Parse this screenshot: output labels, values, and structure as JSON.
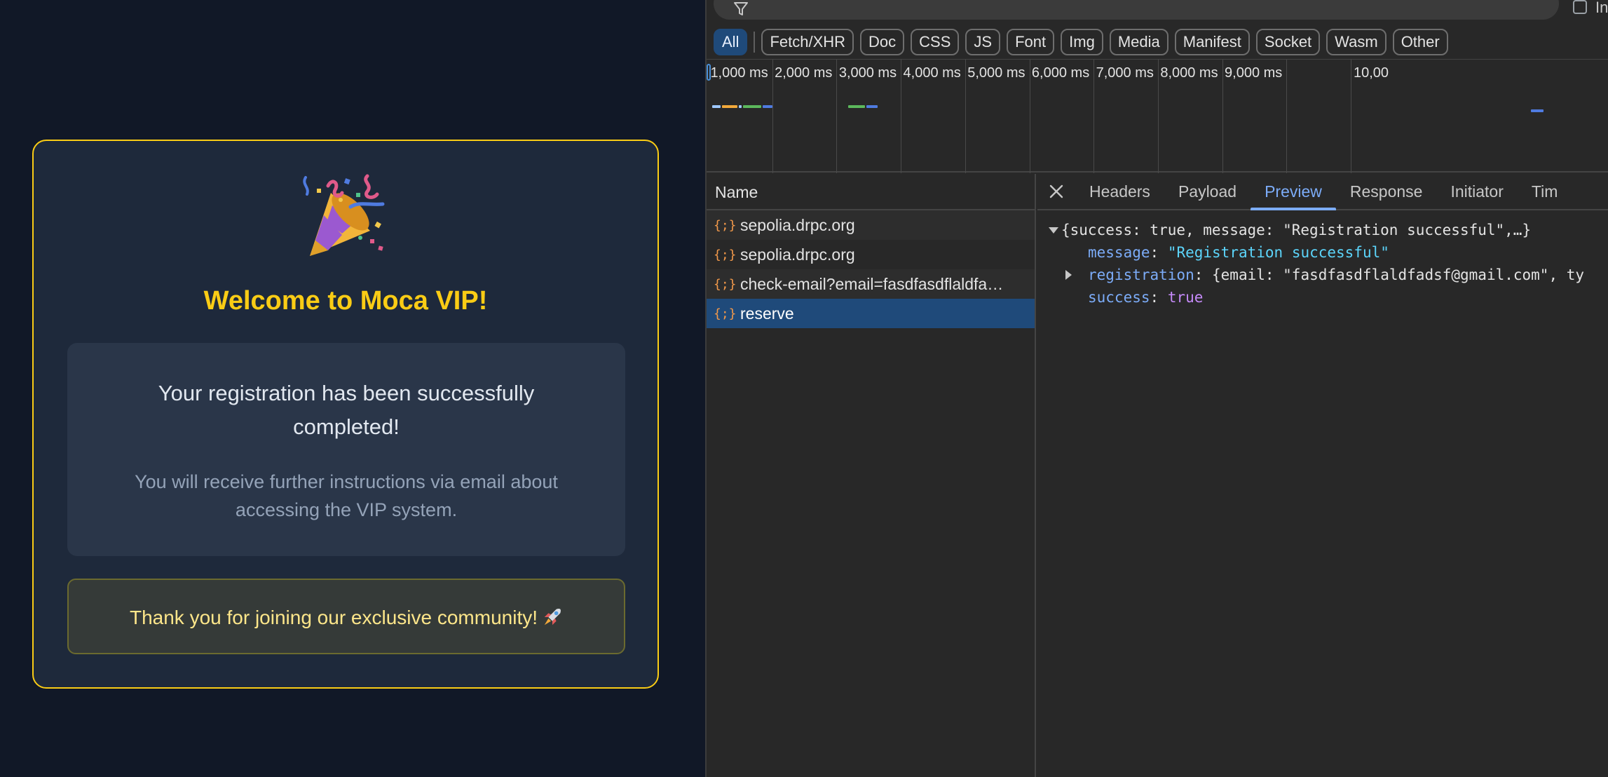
{
  "app": {
    "title": "Welcome to Moca VIP!",
    "message_main": "Your registration has been successfully completed!",
    "message_sub": "You will receive further instructions via email about accessing the VIP system.",
    "thanks": "Thank you for joining our exclusive community!",
    "accent_color": "#facc15",
    "icons": [
      "party-popper-icon",
      "rocket-icon"
    ]
  },
  "devtools": {
    "invert_label": "In",
    "filter_chips": [
      {
        "label": "All",
        "active": true
      },
      {
        "label": "Fetch/XHR"
      },
      {
        "label": "Doc"
      },
      {
        "label": "CSS"
      },
      {
        "label": "JS"
      },
      {
        "label": "Font"
      },
      {
        "label": "Img"
      },
      {
        "label": "Media"
      },
      {
        "label": "Manifest"
      },
      {
        "label": "Socket"
      },
      {
        "label": "Wasm"
      },
      {
        "label": "Other"
      }
    ],
    "timeline_ticks": [
      "1,000 ms",
      "2,000 ms",
      "3,000 ms",
      "4,000 ms",
      "5,000 ms",
      "6,000 ms",
      "7,000 ms",
      "8,000 ms",
      "9,000 ms",
      "10,00"
    ],
    "list_header": "Name",
    "requests": [
      {
        "name": "sepolia.drpc.org"
      },
      {
        "name": "sepolia.drpc.org"
      },
      {
        "name": "check-email?email=fasdfasdflaldfa…"
      },
      {
        "name": "reserve",
        "selected": true
      }
    ],
    "detail_tabs": [
      {
        "label": "Headers"
      },
      {
        "label": "Payload"
      },
      {
        "label": "Preview",
        "active": true
      },
      {
        "label": "Response"
      },
      {
        "label": "Initiator"
      },
      {
        "label": "Tim"
      }
    ],
    "preview": {
      "summary": "{success: true, message: \"Registration successful\",…}",
      "message_key": "message",
      "message_value": "\"Registration successful\"",
      "registration_key": "registration",
      "registration_value": "{email: \"fasdfasdflaldfadsf@gmail.com\", ty",
      "success_key": "success",
      "success_value": "true"
    }
  }
}
